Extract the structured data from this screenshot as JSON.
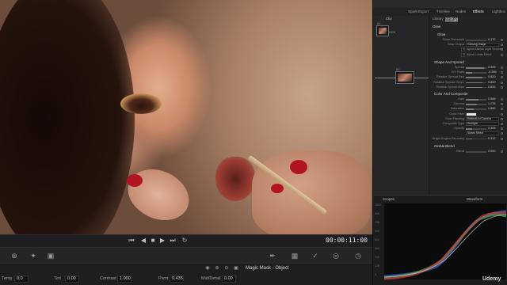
{
  "viewer": {
    "timecode": "00:00:11:00"
  },
  "transport": {
    "buttons": [
      "skip-start-icon",
      "step-back-icon",
      "stop-icon",
      "play-icon",
      "skip-end-icon",
      "loop-icon"
    ]
  },
  "toolbar": {
    "icons": [
      "circle-add-icon",
      "transform-icon",
      "image-icon",
      "pen-icon",
      "grid-icon",
      "eyedropper-icon",
      "target-icon",
      "time-icon"
    ]
  },
  "magic_mask": {
    "title": "Magic Mask - Object",
    "params": [
      {
        "label": "Temp",
        "value": "0.0"
      },
      {
        "label": "Tint",
        "value": "0.00"
      },
      {
        "label": "Contrast",
        "value": "1.000"
      },
      {
        "label": "Pivot",
        "value": "0.435"
      },
      {
        "label": "Mid/Detail",
        "value": "0.00"
      }
    ]
  },
  "topbar": {
    "items": [
      "Spark Export",
      "Timeline",
      "Nodes",
      "Effects",
      "Lightbox"
    ],
    "active": "Effects"
  },
  "nodes": {
    "clip_label": "Clip",
    "node1_label": "01",
    "node2_label": "02"
  },
  "effects": {
    "tabs": [
      "Library",
      "Settings"
    ],
    "title": "Glow",
    "group": "Glow",
    "rows_main": [
      {
        "label": "Shine Threshold",
        "value": "0.170"
      },
      {
        "label": "Glow Output",
        "dropdown": "Glowing Image"
      },
      {
        "label": "Alpha Masks Light Sources",
        "check": true
      },
      {
        "label": "Alpha Limits Effect",
        "check": true
      }
    ],
    "shape_title": "Shape And Spread",
    "rows_shape": [
      {
        "label": "Spread",
        "value": "0.909",
        "fill": 0.9
      },
      {
        "label": "H/V Ratio",
        "value": "-0.390",
        "fill": 0.3
      },
      {
        "label": "Relative Spread Red",
        "value": "0.820",
        "fill": 0.82
      },
      {
        "label": "Relative Spread Green",
        "value": "0.820",
        "fill": 0.82
      },
      {
        "label": "Relative Spread Blue",
        "value": "0.820",
        "fill": 0.82
      }
    ],
    "color_title": "Color And Composite",
    "rows_color": [
      {
        "label": "Gain",
        "value": "0.969",
        "fill": 0.6
      },
      {
        "label": "Gamma",
        "value": "1.276",
        "fill": 0.55
      },
      {
        "label": "Saturation",
        "value": "0.569",
        "fill": 0.4
      },
      {
        "label": "Color Filter",
        "swatch": "#e8e8e8"
      },
      {
        "label": "Glow Flashing",
        "dropdown": "Reflects In Camera"
      },
      {
        "label": "Composite Type",
        "dropdown": "Sunlight"
      },
      {
        "label": "Opacity",
        "value": "0.309",
        "fill": 0.3
      },
      {
        "label": "",
        "dropdown": "Sheen Effect"
      },
      {
        "label": "Bright Region Recovery",
        "value": "0.312",
        "fill": 0.31
      }
    ],
    "blend_title": "Global Blend",
    "rows_blend": [
      {
        "label": "Blend",
        "value": "0.000",
        "fill": 0.0
      }
    ]
  },
  "scopes": {
    "title": "Scopes",
    "mode": "Waveform",
    "scale": [
      "1023",
      "896",
      "768",
      "640",
      "512",
      "384",
      "256",
      "128",
      "0"
    ]
  },
  "watermark": "Udemy"
}
